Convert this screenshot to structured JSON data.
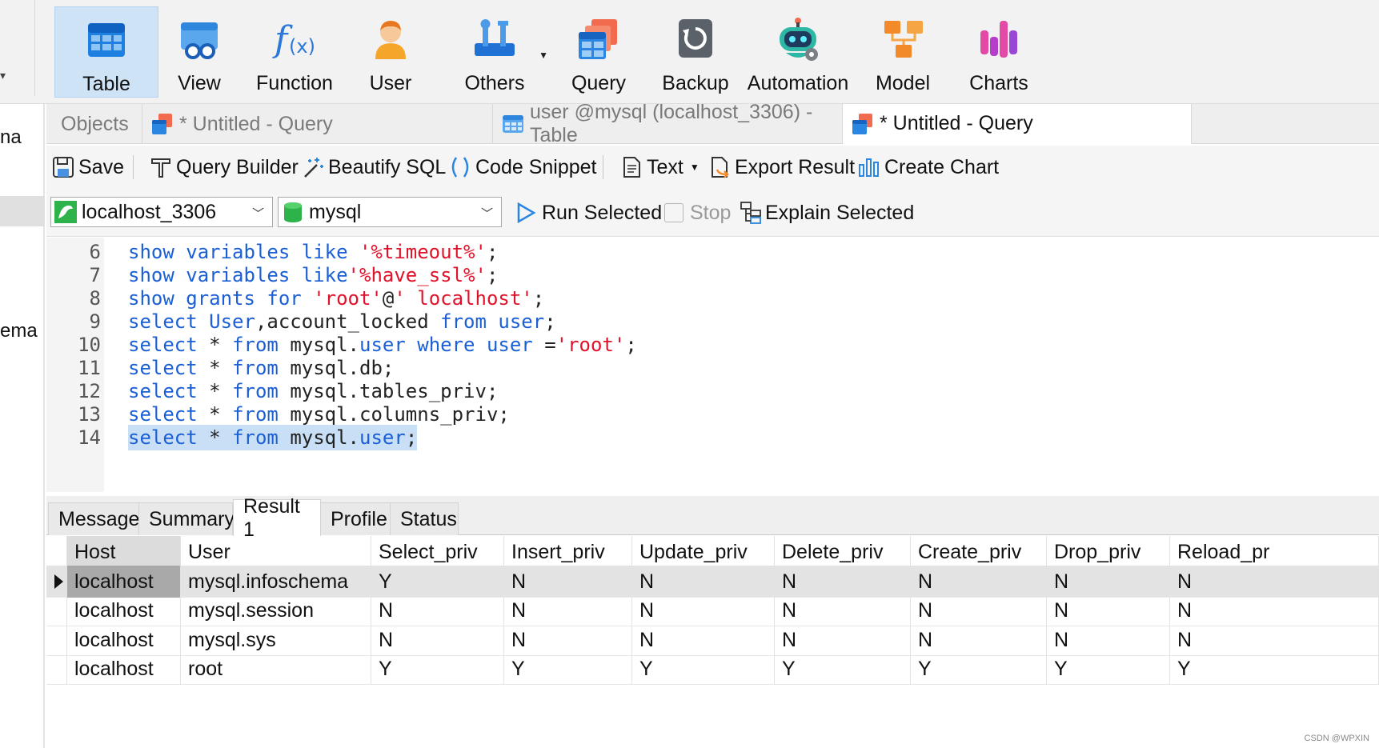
{
  "ribbon": {
    "left_stub_glyph": "▾",
    "buttons": [
      {
        "label": "Table",
        "icon": "table-icon",
        "active": true
      },
      {
        "label": "View",
        "icon": "view-icon"
      },
      {
        "label": "Function",
        "icon": "function-icon"
      },
      {
        "label": "User",
        "icon": "user-icon"
      },
      {
        "label": "Others",
        "icon": "tools-icon"
      },
      {
        "label": "Query",
        "icon": "query-icon"
      },
      {
        "label": "Backup",
        "icon": "backup-icon"
      },
      {
        "label": "Automation",
        "icon": "robot-icon"
      },
      {
        "label": "Model",
        "icon": "model-icon"
      },
      {
        "label": "Charts",
        "icon": "charts-icon"
      }
    ]
  },
  "sidebar": {
    "items": [
      "na",
      "ema"
    ]
  },
  "tabs": [
    {
      "label": "Objects",
      "active": false
    },
    {
      "label": "* Untitled - Query",
      "icon": "query-icon",
      "active": false
    },
    {
      "label": "user @mysql (localhost_3306) - Table",
      "icon": "table-icon",
      "active": false
    },
    {
      "label": "* Untitled - Query",
      "icon": "query-icon",
      "active": true
    }
  ],
  "toolbar": {
    "save": "Save",
    "query_builder": "Query Builder",
    "beautify": "Beautify SQL",
    "snippet": "Code Snippet",
    "text": "Text",
    "export": "Export Result",
    "create_chart": "Create Chart"
  },
  "run_bar": {
    "connection": "localhost_3306",
    "database": "mysql",
    "run_selected": "Run Selected",
    "stop": "Stop",
    "explain": "Explain Selected"
  },
  "editor": {
    "lines": [
      {
        "n": "6",
        "tokens": [
          [
            "kw",
            "show variables like "
          ],
          [
            "str",
            "'%timeout%'"
          ],
          [
            "id",
            ";"
          ]
        ]
      },
      {
        "n": "7",
        "tokens": [
          [
            "kw",
            "show variables like"
          ],
          [
            "str",
            "'%have_ssl%'"
          ],
          [
            "id",
            ";"
          ]
        ]
      },
      {
        "n": "8",
        "tokens": [
          [
            "kw",
            "show grants for "
          ],
          [
            "str",
            "'root'"
          ],
          [
            "id",
            "@"
          ],
          [
            "str",
            "' localhost'"
          ],
          [
            "id",
            ";"
          ]
        ]
      },
      {
        "n": "9",
        "tokens": [
          [
            "kw",
            "select User"
          ],
          [
            "id",
            ",account_locked "
          ],
          [
            "kw",
            "from user"
          ],
          [
            "id",
            ";"
          ]
        ]
      },
      {
        "n": "10",
        "tokens": [
          [
            "kw",
            "select "
          ],
          [
            "id",
            "* "
          ],
          [
            "kw",
            "from "
          ],
          [
            "id",
            "mysql."
          ],
          [
            "kw",
            "user where user "
          ],
          [
            "id",
            "="
          ],
          [
            "str",
            "'root'"
          ],
          [
            "id",
            ";"
          ]
        ]
      },
      {
        "n": "11",
        "tokens": [
          [
            "kw",
            "select "
          ],
          [
            "id",
            "* "
          ],
          [
            "kw",
            "from "
          ],
          [
            "id",
            "mysql.db;"
          ]
        ]
      },
      {
        "n": "12",
        "tokens": [
          [
            "kw",
            "select "
          ],
          [
            "id",
            "* "
          ],
          [
            "kw",
            "from "
          ],
          [
            "id",
            "mysql.tables_priv;"
          ]
        ]
      },
      {
        "n": "13",
        "tokens": [
          [
            "kw",
            "select "
          ],
          [
            "id",
            "* "
          ],
          [
            "kw",
            "from "
          ],
          [
            "id",
            "mysql.columns_priv;"
          ]
        ]
      },
      {
        "n": "14",
        "selected": true,
        "tokens": [
          [
            "kw",
            "select "
          ],
          [
            "id",
            "* "
          ],
          [
            "kw",
            "from "
          ],
          [
            "id",
            "mysql."
          ],
          [
            "kw",
            "user"
          ],
          [
            "id",
            ";"
          ]
        ]
      }
    ]
  },
  "result_tabs": [
    {
      "label": "Message"
    },
    {
      "label": "Summary"
    },
    {
      "label": "Result 1",
      "active": true
    },
    {
      "label": "Profile"
    },
    {
      "label": "Status"
    }
  ],
  "grid": {
    "columns": [
      "Host",
      "User",
      "Select_priv",
      "Insert_priv",
      "Update_priv",
      "Delete_priv",
      "Create_priv",
      "Drop_priv",
      "Reload_pr"
    ],
    "rows": [
      [
        "localhost",
        "mysql.infoschema",
        "Y",
        "N",
        "N",
        "N",
        "N",
        "N",
        "N"
      ],
      [
        "localhost",
        "mysql.session",
        "N",
        "N",
        "N",
        "N",
        "N",
        "N",
        "N"
      ],
      [
        "localhost",
        "mysql.sys",
        "N",
        "N",
        "N",
        "N",
        "N",
        "N",
        "N"
      ],
      [
        "localhost",
        "root",
        "Y",
        "Y",
        "Y",
        "Y",
        "Y",
        "Y",
        "Y"
      ]
    ],
    "current_row": 0
  },
  "watermark": "CSDN @WPXIN",
  "colors": {
    "keyword": "#1a5fd6",
    "string": "#e0122a",
    "selection": "#c8dff5",
    "active_ribbon": "#cfe3f7"
  }
}
